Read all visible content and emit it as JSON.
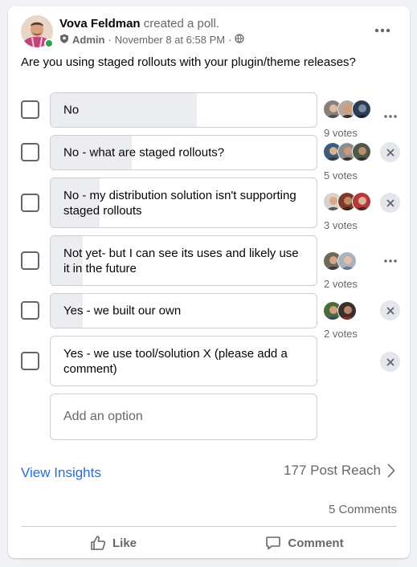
{
  "post": {
    "author": "Vova Feldman",
    "action": "created a poll.",
    "role": "Admin",
    "separator": "·",
    "timestamp": "November 8 at 6:58 PM",
    "question": "Are you using staged rollouts with your plugin/theme releases?"
  },
  "poll": {
    "options": [
      {
        "label": "No",
        "votes_label": "9 votes",
        "votes": 9,
        "voter_count_shown": 3,
        "action": "more"
      },
      {
        "label": "No - what are staged rollouts?",
        "votes_label": "5 votes",
        "votes": 5,
        "voter_count_shown": 3,
        "action": "remove"
      },
      {
        "label": "No - my distribution solution isn't supporting staged rollouts",
        "votes_label": "3 votes",
        "votes": 3,
        "voter_count_shown": 3,
        "action": "remove"
      },
      {
        "label": "Not yet- but I can see its uses and likely use it in the future",
        "votes_label": "2 votes",
        "votes": 2,
        "voter_count_shown": 2,
        "action": "more"
      },
      {
        "label": "Yes - we built our own",
        "votes_label": "2 votes",
        "votes": 2,
        "voter_count_shown": 2,
        "action": "remove"
      },
      {
        "label": "Yes - we use tool/solution X (please add a comment)",
        "votes_label": "",
        "votes": 0,
        "voter_count_shown": 0,
        "action": "remove"
      }
    ],
    "add_option_placeholder": "Add an option"
  },
  "footer": {
    "insights_label": "View Insights",
    "reach_label": "177 Post Reach",
    "comments_label": "5 Comments",
    "like_label": "Like",
    "comment_label": "Comment"
  },
  "icons": {
    "admin": "shield-icon",
    "audience": "globe-icon",
    "more": "more-horizontal-icon",
    "remove": "close-icon",
    "reach": "chevron-right-icon",
    "like": "thumbs-up-icon",
    "comment": "comment-bubble-icon"
  },
  "colors": {
    "link": "#216fdb",
    "online": "#31a24c",
    "vote_fill": "#ebedf0",
    "secondary_text": "#65676b"
  }
}
